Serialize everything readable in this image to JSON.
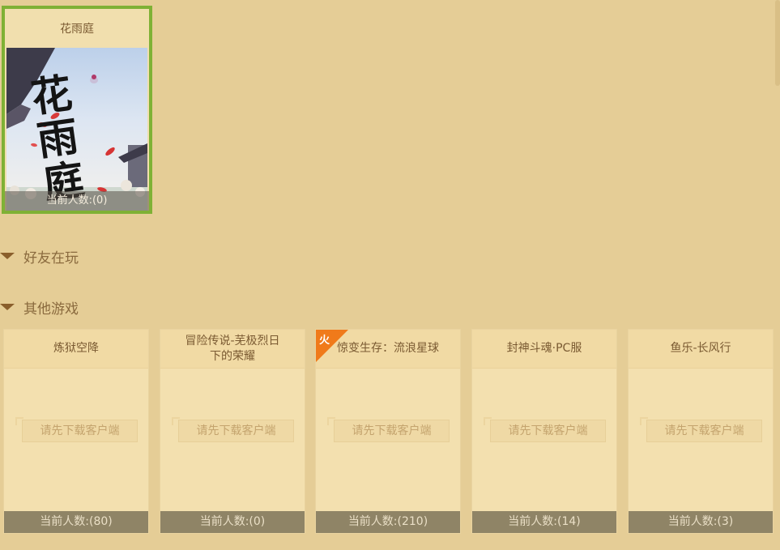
{
  "featured": {
    "title": "花雨庭",
    "count": "当前人数:(0)",
    "image_calligraphy": "花雨庭"
  },
  "sections": {
    "friends": "好友在玩",
    "others": "其他游戏"
  },
  "games": [
    {
      "title": "炼狱空降",
      "download": "请先下载客户端",
      "count": "当前人数:(80)",
      "hot": false
    },
    {
      "title": "冒险传说-芜极烈日下的荣耀",
      "download": "请先下载客户端",
      "count": "当前人数:(0)",
      "hot": false
    },
    {
      "title": "惊变生存：流浪星球",
      "download": "请先下载客户端",
      "count": "当前人数:(210)",
      "hot": true,
      "hot_label": "火"
    },
    {
      "title": "封神斗魂·PC服",
      "download": "请先下载客户端",
      "count": "当前人数:(14)",
      "hot": false
    },
    {
      "title": "鱼乐-长风行",
      "download": "请先下载客户端",
      "count": "当前人数:(3)",
      "hot": false
    }
  ],
  "colors": {
    "background": "#e5cd96",
    "selected_border": "#7fb135",
    "hot_badge": "#f07a1a",
    "count_bar": "#8f8466"
  }
}
